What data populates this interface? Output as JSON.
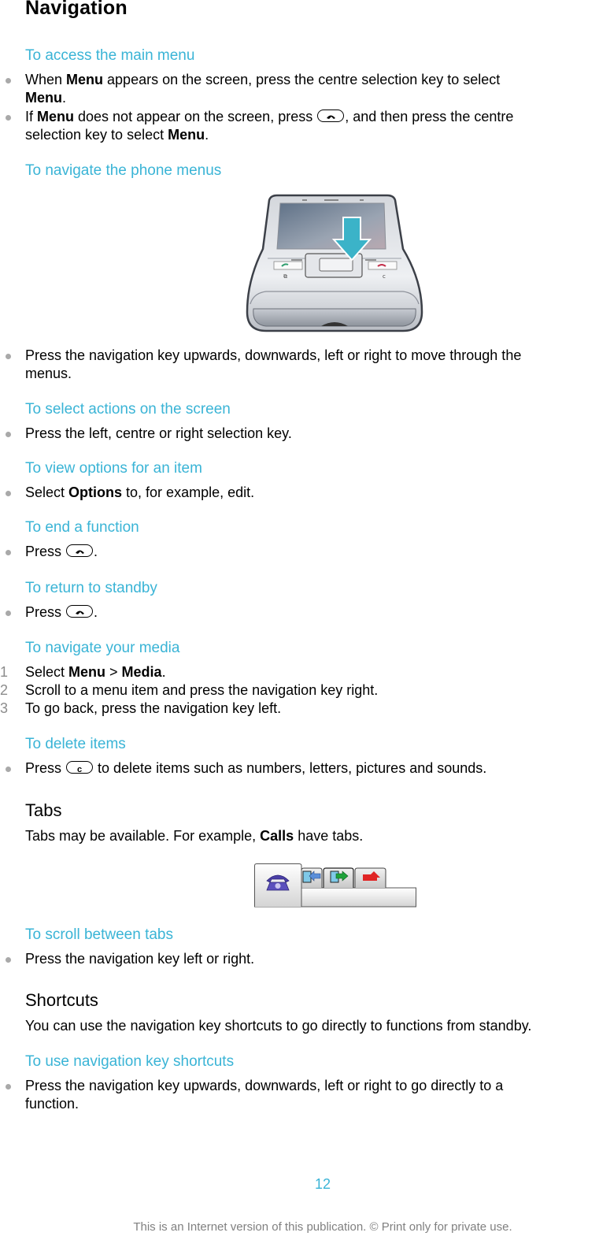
{
  "page": {
    "title": "Navigation",
    "accent_color": "#3ab4d6"
  },
  "sections": {
    "access_menu": {
      "heading": "To access the main menu",
      "b1_pre": "When ",
      "b1_bold": "Menu",
      "b1_post": " appears on the screen, press the centre selection key to select",
      "b1_line2_bold": "Menu",
      "b1_line2_post": ".",
      "b2_pre": "If ",
      "b2_bold": "Menu",
      "b2_mid": " does not appear on the screen, press ",
      "b2_post": ", and then press the centre",
      "b2_line2_pre": "selection key to select ",
      "b2_line2_bold": "Menu",
      "b2_line2_post": "."
    },
    "navigate_phone": {
      "heading": "To navigate the phone menus",
      "b1_line1": "Press the navigation key upwards, downwards, left or right to move through the",
      "b1_line2": "menus."
    },
    "select_actions": {
      "heading": "To select actions on the screen",
      "b1": "Press the left, centre or right selection key."
    },
    "view_options": {
      "heading": "To view options for an item",
      "b1_pre": "Select ",
      "b1_bold": "Options",
      "b1_post": " to, for example, edit."
    },
    "end_function": {
      "heading": "To end a function",
      "b1_pre": "Press ",
      "b1_post": "."
    },
    "return_standby": {
      "heading": "To return to standby",
      "b1_pre": "Press ",
      "b1_post": "."
    },
    "navigate_media": {
      "heading": "To navigate your media",
      "steps": [
        {
          "n": "1",
          "pre": "Select ",
          "bold1": "Menu",
          "mid": " > ",
          "bold2": "Media",
          "post": "."
        },
        {
          "n": "2",
          "text": "Scroll to a menu item and press the navigation key right."
        },
        {
          "n": "3",
          "text": "To go back, press the navigation key left."
        }
      ]
    },
    "delete_items": {
      "heading": "To delete items",
      "b1_pre": "Press ",
      "key_label": "c",
      "b1_post": " to delete items such as numbers, letters, pictures and sounds."
    },
    "tabs": {
      "heading": "Tabs",
      "body_pre": "Tabs may be available. For example, ",
      "body_bold": "Calls",
      "body_post": " have tabs.",
      "tab_icons": [
        "phone-icon",
        "received-call-icon",
        "dialled-call-icon",
        "missed-call-icon"
      ]
    },
    "scroll_tabs": {
      "heading": "To scroll between tabs",
      "b1": "Press the navigation key left or right."
    },
    "shortcuts": {
      "heading": "Shortcuts",
      "body": "You can use the navigation key shortcuts to go directly to functions from standby."
    },
    "use_shortcuts": {
      "heading": "To use navigation key shortcuts",
      "b1_line1": "Press the navigation key upwards, downwards, left or right to go directly to a",
      "b1_line2": "function."
    }
  },
  "footer": {
    "page_number": "12",
    "note": "This is an Internet version of this publication. © Print only for private use."
  }
}
